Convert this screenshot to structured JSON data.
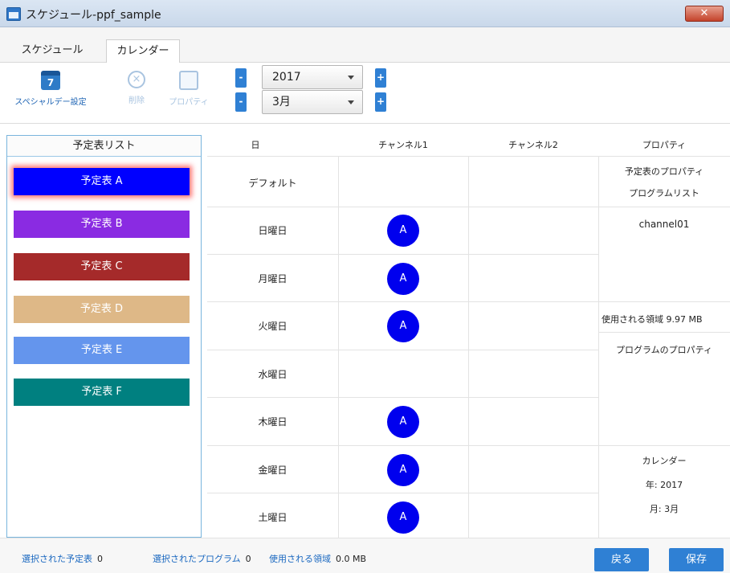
{
  "window": {
    "title": "スケジュール-ppf_sample",
    "close_label": "✕"
  },
  "tabs": [
    {
      "label": "スケジュール",
      "active": false
    },
    {
      "label": "カレンダー",
      "active": true
    }
  ],
  "toolbar": {
    "special_day_label": "スペシャルデー設定",
    "special_day_icon_text": "7",
    "delete_label": "削除",
    "properties_label": "プロパティ",
    "year_value": "2017",
    "month_value": "3月",
    "minus": "-",
    "plus": "+"
  },
  "sidebar": {
    "header": "予定表リスト",
    "plans": [
      {
        "label": "予定表 A",
        "color": "#0000ff",
        "selected": true
      },
      {
        "label": "予定表 B",
        "color": "#8a2be2",
        "selected": false
      },
      {
        "label": "予定表 C",
        "color": "#a52a2a",
        "selected": false
      },
      {
        "label": "予定表 D",
        "color": "#deb887",
        "selected": false
      },
      {
        "label": "予定表 E",
        "color": "#6495ed",
        "selected": false
      },
      {
        "label": "予定表 F",
        "color": "#008080",
        "selected": false
      }
    ]
  },
  "grid": {
    "headers": [
      "日",
      "チャンネル1",
      "チャンネル2",
      "プロパティ"
    ],
    "rows": [
      {
        "day": "デフォルト",
        "ch1": "",
        "ch2": ""
      },
      {
        "day": "日曜日",
        "ch1": "A",
        "ch2": ""
      },
      {
        "day": "月曜日",
        "ch1": "A",
        "ch2": ""
      },
      {
        "day": "火曜日",
        "ch1": "A",
        "ch2": ""
      },
      {
        "day": "水曜日",
        "ch1": "",
        "ch2": ""
      },
      {
        "day": "木曜日",
        "ch1": "A",
        "ch2": ""
      },
      {
        "day": "金曜日",
        "ch1": "A",
        "ch2": ""
      },
      {
        "day": "土曜日",
        "ch1": "A",
        "ch2": ""
      }
    ],
    "badge_color": "#0000ee"
  },
  "properties": {
    "plan_props": "予定表のプロパティ",
    "program_list": "プログラムリスト",
    "channel": "channel01",
    "used_area": "使用される領域 9.97 MB",
    "program_props": "プログラムのプロパティ",
    "calendar": "カレンダー",
    "year": "年: 2017",
    "month": "月: 3月"
  },
  "status": {
    "selected_plan_label": "選択された予定表",
    "selected_plan_value": "0",
    "selected_program_label": "選択されたプログラム",
    "selected_program_value": "0",
    "used_area_label": "使用される領域",
    "used_area_value": "0.0 MB",
    "back_label": "戻る",
    "save_label": "保存"
  }
}
